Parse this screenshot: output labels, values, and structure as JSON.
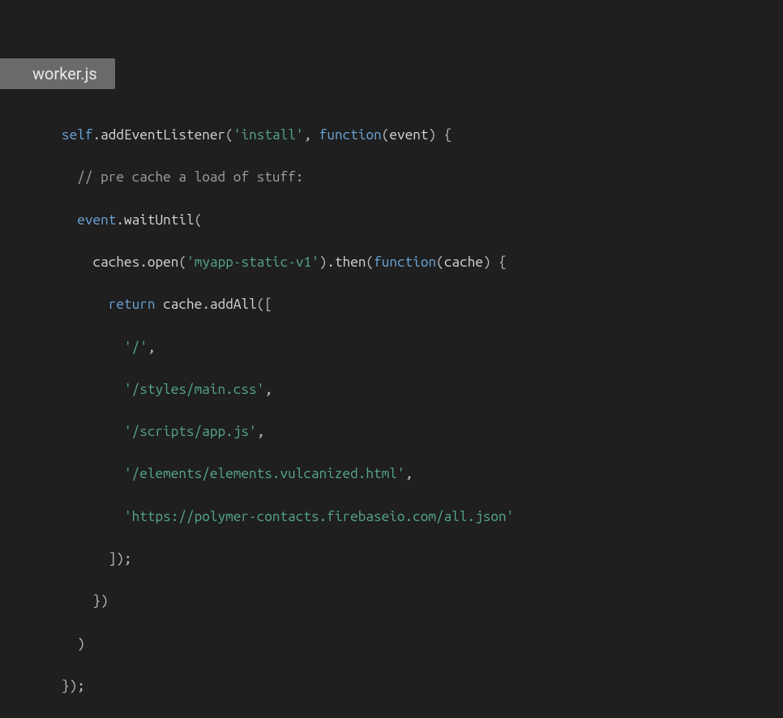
{
  "file_tab": {
    "label": "worker.js"
  },
  "code": {
    "l1": {
      "self": "self",
      "dot1": ".",
      "method": "addEventListener",
      "openParen": "(",
      "str1": "'install'",
      "comma": ", ",
      "kw": "function",
      "openParen2": "(",
      "param": "event",
      "closeParen": ") {"
    },
    "l2": {
      "indent": "  ",
      "comment": "// pre cache a load of stuff:"
    },
    "l3": {
      "indent": "  ",
      "obj": "event",
      "dot": ".",
      "method": "waitUntil",
      "open": "("
    },
    "l4": {
      "indent": "    ",
      "obj": "caches",
      "dot": ".",
      "m1": "open",
      "open1": "(",
      "str": "'myapp-static-v1'",
      "close1": ")",
      "dot2": ".",
      "m2": "then",
      "open2": "(",
      "kw": "function",
      "open3": "(",
      "param": "cache",
      "close3": ") {"
    },
    "l5": {
      "indent": "      ",
      "kw": "return",
      "sp": " ",
      "obj": "cache",
      "dot": ".",
      "m": "addAll",
      "open": "(["
    },
    "l6": {
      "indent": "        ",
      "str": "'/'",
      "comma": ","
    },
    "l7": {
      "indent": "        ",
      "str": "'/styles/main.css'",
      "comma": ","
    },
    "l8": {
      "indent": "        ",
      "str": "'/scripts/app.js'",
      "comma": ","
    },
    "l9": {
      "indent": "        ",
      "str": "'/elements/elements.vulcanized.html'",
      "comma": ","
    },
    "l10": {
      "indent": "        ",
      "str": "'https://polymer-contacts.firebaseio.com/all.json'"
    },
    "l11": {
      "indent": "      ",
      "close": "]);"
    },
    "l12": {
      "indent": "    ",
      "close": "})"
    },
    "l13": {
      "indent": "  ",
      "close": ")"
    },
    "l14": {
      "close": "});"
    }
  }
}
